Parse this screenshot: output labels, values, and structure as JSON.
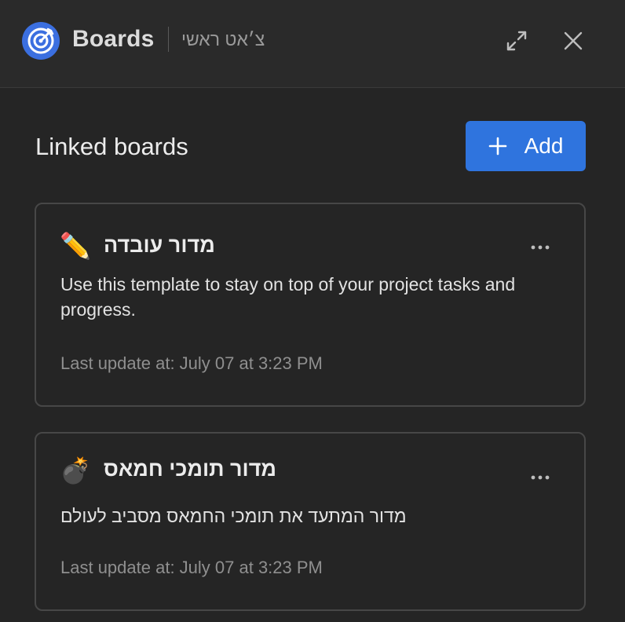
{
  "header": {
    "app_title": "Boards",
    "channel_name": "צ׳אט ראשי",
    "logo_icon": "target-logo-icon",
    "expand_icon": "expand-icon",
    "close_icon": "close-icon"
  },
  "section": {
    "title": "Linked boards",
    "add_label": "Add",
    "add_icon": "plus-icon"
  },
  "boards": [
    {
      "emoji": "✏️",
      "title": "מדור עובדה",
      "description": "Use this template to stay on top of your project tasks and progress.",
      "last_update": "Last update at: July 07 at 3:23 PM"
    },
    {
      "emoji": "💣",
      "title": "מדור תומכי חמאס",
      "description": "מדור המתעד את תומכי החמאס מסביב לעולם",
      "last_update": "Last update at: July 07 at 3:23 PM"
    }
  ],
  "colors": {
    "background": "#252525",
    "accent": "#2f74de",
    "logo": "#3b6fe0"
  }
}
